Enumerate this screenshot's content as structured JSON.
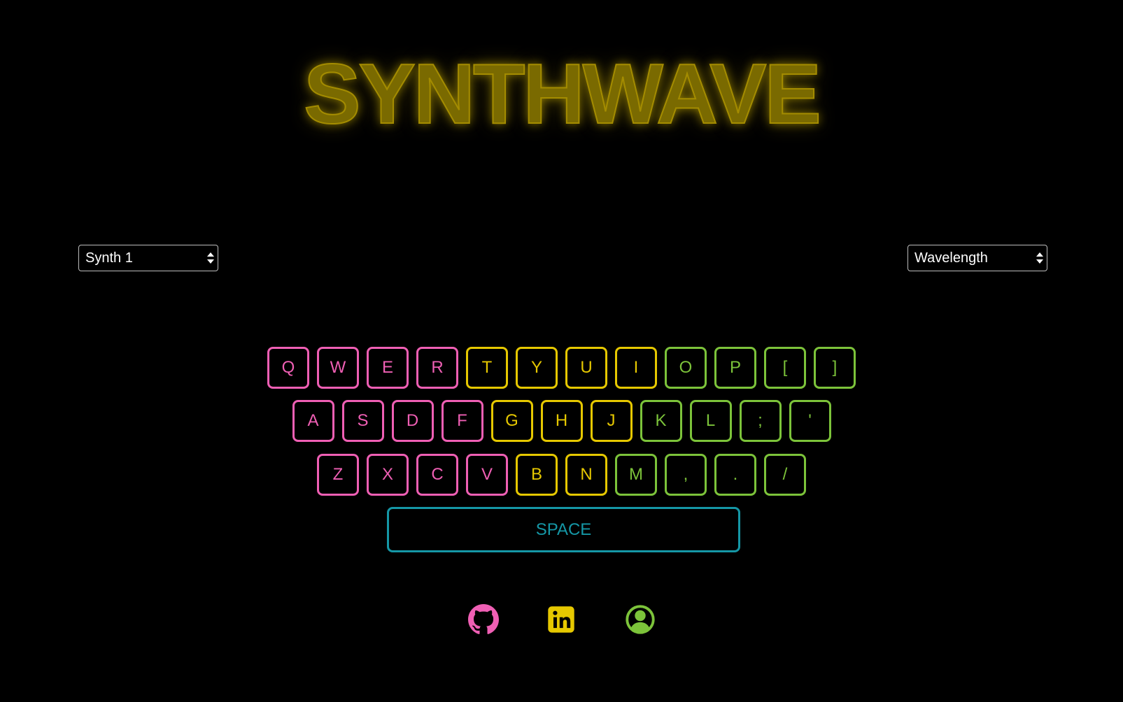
{
  "title": "SYNTHWAVE",
  "controls": {
    "synth_select": {
      "value": "Synth 1"
    },
    "effect_select": {
      "value": "Wavelength"
    }
  },
  "keyboard": {
    "rows": [
      [
        {
          "label": "Q",
          "color": "pink"
        },
        {
          "label": "W",
          "color": "pink"
        },
        {
          "label": "E",
          "color": "pink"
        },
        {
          "label": "R",
          "color": "pink"
        },
        {
          "label": "T",
          "color": "yellow"
        },
        {
          "label": "Y",
          "color": "yellow"
        },
        {
          "label": "U",
          "color": "yellow"
        },
        {
          "label": "I",
          "color": "yellow"
        },
        {
          "label": "O",
          "color": "green"
        },
        {
          "label": "P",
          "color": "green"
        },
        {
          "label": "[",
          "color": "green"
        },
        {
          "label": "]",
          "color": "green"
        }
      ],
      [
        {
          "label": "A",
          "color": "pink"
        },
        {
          "label": "S",
          "color": "pink"
        },
        {
          "label": "D",
          "color": "pink"
        },
        {
          "label": "F",
          "color": "pink"
        },
        {
          "label": "G",
          "color": "yellow"
        },
        {
          "label": "H",
          "color": "yellow"
        },
        {
          "label": "J",
          "color": "yellow"
        },
        {
          "label": "K",
          "color": "green"
        },
        {
          "label": "L",
          "color": "green"
        },
        {
          "label": ";",
          "color": "green"
        },
        {
          "label": "'",
          "color": "green"
        }
      ],
      [
        {
          "label": "Z",
          "color": "pink"
        },
        {
          "label": "X",
          "color": "pink"
        },
        {
          "label": "C",
          "color": "pink"
        },
        {
          "label": "V",
          "color": "pink"
        },
        {
          "label": "B",
          "color": "yellow"
        },
        {
          "label": "N",
          "color": "yellow"
        },
        {
          "label": "M",
          "color": "green"
        },
        {
          "label": ",",
          "color": "green"
        },
        {
          "label": ".",
          "color": "green"
        },
        {
          "label": "/",
          "color": "green"
        }
      ]
    ],
    "space_label": "SPACE"
  },
  "colors": {
    "pink": "#ef5fb4",
    "yellow": "#e6c800",
    "green": "#7cc33a",
    "teal": "#1597a6",
    "title": "#7a6a00",
    "background": "#000000"
  },
  "social": [
    {
      "icon": "github-icon",
      "color": "#ef5fb4"
    },
    {
      "icon": "linkedin-icon",
      "color": "#e6c800"
    },
    {
      "icon": "user-icon",
      "color": "#7cc33a"
    }
  ]
}
